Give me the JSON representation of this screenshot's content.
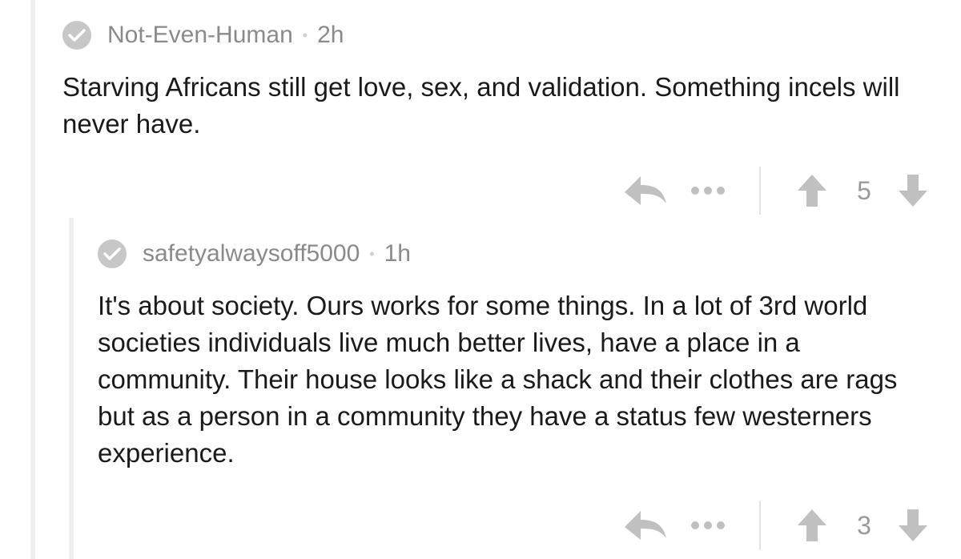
{
  "comments": [
    {
      "author": "Not-Even-Human",
      "age": "2h",
      "body": "Starving Africans still get love, sex, and validation. Something incels will never have.",
      "score": "5"
    },
    {
      "author": "safetyalwaysoff5000",
      "age": "1h",
      "body": "It's about society. Ours works for some things. In a lot of 3rd world societies individuals live much better lives, have a place in a community. Their house looks like a shack and their clothes are rags but as a person in a community they have a status few westerners experience.",
      "score": "3"
    }
  ],
  "meta_separator": "•",
  "colors": {
    "icon_gray": "#c0c0c0",
    "meta_gray": "#8a8a8a",
    "text": "#1a1a1a",
    "indent_line": "#efefef"
  },
  "icons": {
    "author_badge": "check-circle-icon",
    "reply": "reply-arrow-icon",
    "more": "ellipsis-icon",
    "upvote": "up-arrow-icon",
    "downvote": "down-arrow-icon"
  }
}
